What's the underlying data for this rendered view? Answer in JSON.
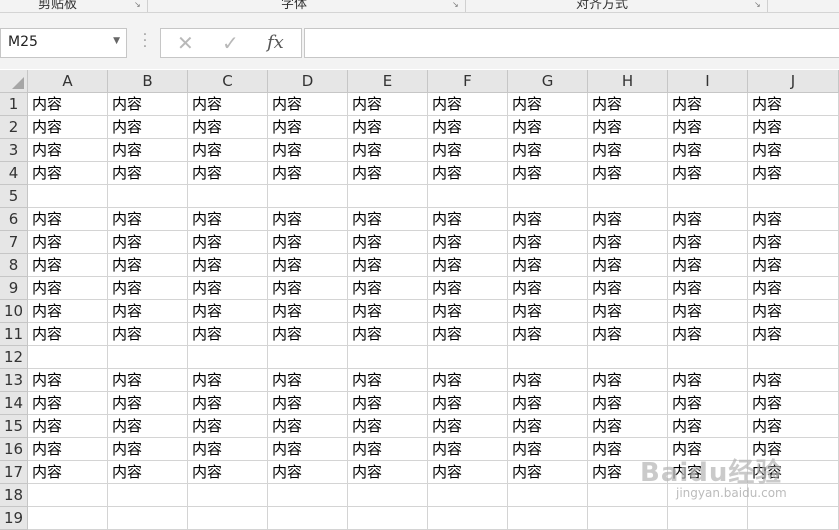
{
  "ribbon": {
    "groups": [
      {
        "label": "剪贴板"
      },
      {
        "label": "字体"
      },
      {
        "label": "对齐方式"
      }
    ]
  },
  "formula_bar": {
    "name_box": "M25",
    "name_box_icon": "chevron-down-icon",
    "cancel_icon": "close-icon",
    "enter_icon": "checkmark-icon",
    "function_label": "fx",
    "formula": ""
  },
  "sheet": {
    "columns": [
      "A",
      "B",
      "C",
      "D",
      "E",
      "F",
      "G",
      "H",
      "I",
      "J"
    ],
    "rows": [
      {
        "num": "1",
        "cells": [
          "内容",
          "内容",
          "内容",
          "内容",
          "内容",
          "内容",
          "内容",
          "内容",
          "内容",
          "内容"
        ]
      },
      {
        "num": "2",
        "cells": [
          "内容",
          "内容",
          "内容",
          "内容",
          "内容",
          "内容",
          "内容",
          "内容",
          "内容",
          "内容"
        ]
      },
      {
        "num": "3",
        "cells": [
          "内容",
          "内容",
          "内容",
          "内容",
          "内容",
          "内容",
          "内容",
          "内容",
          "内容",
          "内容"
        ]
      },
      {
        "num": "4",
        "cells": [
          "内容",
          "内容",
          "内容",
          "内容",
          "内容",
          "内容",
          "内容",
          "内容",
          "内容",
          "内容"
        ]
      },
      {
        "num": "5",
        "cells": [
          "",
          "",
          "",
          "",
          "",
          "",
          "",
          "",
          "",
          ""
        ]
      },
      {
        "num": "6",
        "cells": [
          "内容",
          "内容",
          "内容",
          "内容",
          "内容",
          "内容",
          "内容",
          "内容",
          "内容",
          "内容"
        ]
      },
      {
        "num": "7",
        "cells": [
          "内容",
          "内容",
          "内容",
          "内容",
          "内容",
          "内容",
          "内容",
          "内容",
          "内容",
          "内容"
        ]
      },
      {
        "num": "8",
        "cells": [
          "内容",
          "内容",
          "内容",
          "内容",
          "内容",
          "内容",
          "内容",
          "内容",
          "内容",
          "内容"
        ]
      },
      {
        "num": "9",
        "cells": [
          "内容",
          "内容",
          "内容",
          "内容",
          "内容",
          "内容",
          "内容",
          "内容",
          "内容",
          "内容"
        ]
      },
      {
        "num": "10",
        "cells": [
          "内容",
          "内容",
          "内容",
          "内容",
          "内容",
          "内容",
          "内容",
          "内容",
          "内容",
          "内容"
        ]
      },
      {
        "num": "11",
        "cells": [
          "内容",
          "内容",
          "内容",
          "内容",
          "内容",
          "内容",
          "内容",
          "内容",
          "内容",
          "内容"
        ]
      },
      {
        "num": "12",
        "cells": [
          "",
          "",
          "",
          "",
          "",
          "",
          "",
          "",
          "",
          ""
        ]
      },
      {
        "num": "13",
        "cells": [
          "内容",
          "内容",
          "内容",
          "内容",
          "内容",
          "内容",
          "内容",
          "内容",
          "内容",
          "内容"
        ]
      },
      {
        "num": "14",
        "cells": [
          "内容",
          "内容",
          "内容",
          "内容",
          "内容",
          "内容",
          "内容",
          "内容",
          "内容",
          "内容"
        ]
      },
      {
        "num": "15",
        "cells": [
          "内容",
          "内容",
          "内容",
          "内容",
          "内容",
          "内容",
          "内容",
          "内容",
          "内容",
          "内容"
        ]
      },
      {
        "num": "16",
        "cells": [
          "内容",
          "内容",
          "内容",
          "内容",
          "内容",
          "内容",
          "内容",
          "内容",
          "内容",
          "内容"
        ]
      },
      {
        "num": "17",
        "cells": [
          "内容",
          "内容",
          "内容",
          "内容",
          "内容",
          "内容",
          "内容",
          "内容",
          "内容",
          "内容"
        ]
      },
      {
        "num": "18",
        "cells": [
          "",
          "",
          "",
          "",
          "",
          "",
          "",
          "",
          "",
          ""
        ]
      },
      {
        "num": "19",
        "cells": [
          "",
          "",
          "",
          "",
          "",
          "",
          "",
          "",
          "",
          ""
        ]
      }
    ]
  },
  "watermark": {
    "brand": "Baidu经验",
    "url": "jingyan.baidu.com"
  }
}
